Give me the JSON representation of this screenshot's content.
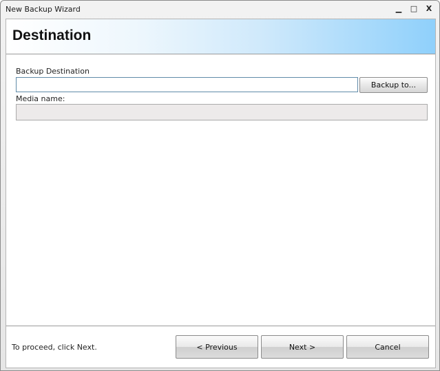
{
  "window": {
    "title": "New Backup Wizard",
    "controls": {
      "minimize": "▁",
      "maximize": "□",
      "close": "X"
    }
  },
  "header": {
    "title": "Destination"
  },
  "form": {
    "destination_label": "Backup Destination",
    "destination_value": "",
    "backup_to_button": "Backup to...",
    "media_label": "Media name:",
    "media_value": ""
  },
  "footer": {
    "status": "To proceed, click Next.",
    "previous_button": "< Previous",
    "next_button": "Next >",
    "cancel_button": "Cancel"
  },
  "colors": {
    "header_gradient_end": "#8fd0fb",
    "input_border_focus": "#5f8aa8",
    "disabled_field": "#edeaea"
  }
}
